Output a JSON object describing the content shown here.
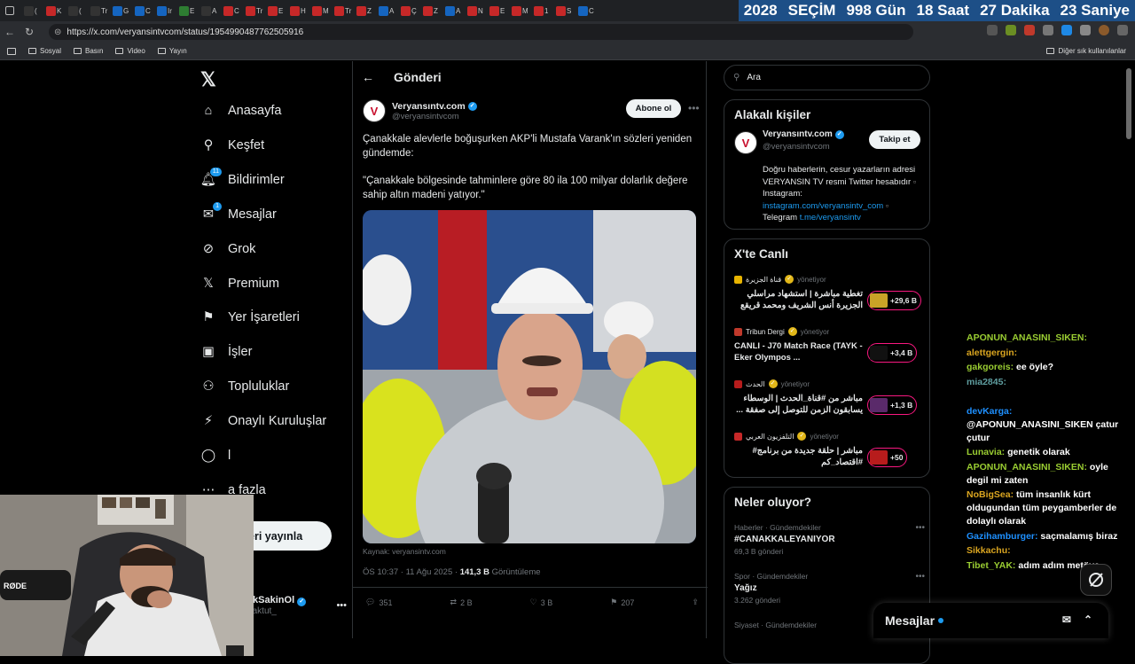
{
  "browser": {
    "url": "https://x.com/veryansintvcom/status/1954990487762505916",
    "tab_labels": [
      "(",
      "K",
      "(",
      "Tr",
      "G",
      "C",
      "Ir",
      "E",
      "A",
      "C",
      "Tr",
      "E",
      "H",
      "M",
      "Tr",
      "Z",
      "A",
      "Ç",
      "Z",
      "A",
      "N",
      "E",
      "M",
      "1",
      "S",
      "C"
    ],
    "bookmarks": [
      "Sosyal",
      "Basın",
      "Video",
      "Yayın"
    ],
    "bookmarks_right": "Diğer sık kullanılanlar"
  },
  "countdown": {
    "year": "2028",
    "label": "SEÇİM",
    "days": "998 Gün",
    "hours": "18 Saat",
    "minutes": "27 Dakika",
    "seconds": "23 Saniye"
  },
  "nav": {
    "items": [
      {
        "label": "Anasayfa",
        "icon": "home-icon"
      },
      {
        "label": "Keşfet",
        "icon": "search-icon"
      },
      {
        "label": "Bildirimler",
        "icon": "bell-icon",
        "badge": "11"
      },
      {
        "label": "Mesajlar",
        "icon": "mail-icon",
        "badge": "1"
      },
      {
        "label": "Grok",
        "icon": "grok-icon"
      },
      {
        "label": "Premium",
        "icon": "x-icon"
      },
      {
        "label": "Yer İşaretleri",
        "icon": "bookmark-icon"
      },
      {
        "label": "İşler",
        "icon": "briefcase-icon"
      },
      {
        "label": "Topluluklar",
        "icon": "people-icon"
      },
      {
        "label": "Onaylı Kuruluşlar",
        "icon": "lightning-icon"
      },
      {
        "label": "l",
        "icon": "person-icon"
      },
      {
        "label": "a fazla",
        "icon": "more-icon"
      }
    ],
    "post_button": "eri yayınla",
    "account": {
      "name": "BurakSakinOl",
      "handle": "@buraktut_"
    }
  },
  "post": {
    "header": "Gönderi",
    "author_name": "Veryansıntv.com",
    "author_handle": "@veryansintvcom",
    "subscribe": "Abone ol",
    "text1": "Çanakkale alevlerle boğuşurken AKP'li Mustafa Varank'ın sözleri yeniden gündemde:",
    "text2": "\"Çanakkale bölgesinde tahminlere göre 80 ila 100 milyar dolarlık değere sahip altın madeni yatıyor.\"",
    "source": "Kaynak: veryansintv.com",
    "time": "ÖS 10:37 · 11 Ağu 2025 · ",
    "views": "141,3 B",
    "views_label": " Görüntüleme",
    "replies": "351",
    "reposts": "2 B",
    "likes": "3 B",
    "bookmarks": "207"
  },
  "sidebar": {
    "search_placeholder": "Ara",
    "related_title": "Alakalı kişiler",
    "related": {
      "name": "Veryansıntv.com",
      "handle": "@veryansintvcom",
      "follow": "Takip et",
      "bio1": "Doğru haberlerin, cesur yazarların adresi VERYANSIN TV resmi Twitter hesabıdır",
      "bio2": " Instagram:",
      "bio_link1": "instagram.com/veryansintv_com",
      "bio3": " Telegram ",
      "bio_link2": "t.me/veryansintv"
    },
    "live_title": "X'te Canlı",
    "live": [
      {
        "source": "قناة الجزيرة",
        "mod": "yönetiyor",
        "title": "تغطية مباشرة | استشهاد مراسلي الجزيرة أنس الشريف ومحمد قريقع",
        "count": "+29,6 B",
        "rtl": true
      },
      {
        "source": "Tribun Dergi",
        "mod": "yönetiyor",
        "title": "CANLI - J70 Match Race (TAYK - Eker Olympos ...",
        "count": "+3,4 B",
        "rtl": false
      },
      {
        "source": "الحدث",
        "mod": "yönetiyor",
        "title": "مباشر من #قناة_الحدث | الوسطاء يسابقون الزمن للتوصل إلى صفقة ...",
        "count": "+1,3 B",
        "rtl": true
      },
      {
        "source": "التلفزيون العربي",
        "mod": "yönetiyor",
        "title": "مباشر | حلقة جديدة من برنامج# #اقتصاد_كم",
        "count": "+50",
        "rtl": true
      }
    ],
    "trends_title": "Neler oluyor?",
    "trends": [
      {
        "cat": "Haberler · Gündemdekiler",
        "title": "#CANAKKALEYANIYOR",
        "count": "69,3 B gönderi"
      },
      {
        "cat": "Spor · Gündemdekiler",
        "title": "Yağız",
        "count": "3.262 gönderi"
      },
      {
        "cat": "Siyaset · Gündemdekiler",
        "title": "",
        "count": ""
      }
    ]
  },
  "chat": [
    {
      "user": "APONUN_ANASINI_SIKEN:",
      "msg": "",
      "color": "#9acd32"
    },
    {
      "user": "alettgergin:",
      "msg": "",
      "color": "#daa520"
    },
    {
      "user": "gakgoreis:",
      "msg": "ee öyle?",
      "color": "#9acd32"
    },
    {
      "user": "mia2845:",
      "msg": "",
      "color": "#5f9ea0"
    },
    {
      "user": "",
      "msg": "",
      "color": "#ffffff"
    },
    {
      "user": "devKarga:",
      "msg": "@APONUN_ANASINI_SIKEN çatur çutur",
      "color": "#1e90ff"
    },
    {
      "user": "Lunavia:",
      "msg": "genetik olarak",
      "color": "#9acd32"
    },
    {
      "user": "APONUN_ANASINI_SIKEN:",
      "msg": "oyle degil mi zaten",
      "color": "#9acd32"
    },
    {
      "user": "NoBigSea:",
      "msg": "tüm insanlık kürt oldugundan tüm peygamberler de dolaylı olarak",
      "color": "#daa520"
    },
    {
      "user": "Gazihamburger:",
      "msg": "saçmalamış biraz",
      "color": "#1e90ff"
    },
    {
      "user": "Sikkachu:",
      "msg": "",
      "color": "#daa520"
    },
    {
      "user": "Tibet_YAK:",
      "msg": "adım adım metöye",
      "color": "#9acd32"
    }
  ],
  "dm": {
    "label": "Mesajlar"
  },
  "colors": {
    "accent": "#1d9bf0",
    "live": "#f91880",
    "countdown_bg": "#1d4f87"
  }
}
